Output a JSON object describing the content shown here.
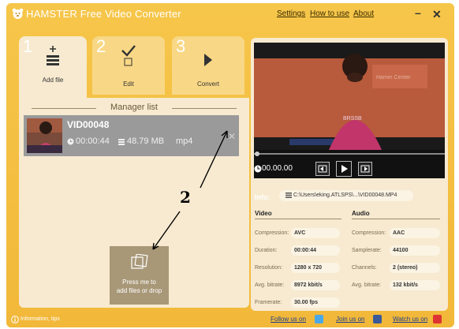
{
  "app": {
    "title": "HAMSTER Free Video Converter",
    "menu": {
      "settings": "Settings",
      "how_to_use": "How to use",
      "about": "About"
    },
    "window_buttons": {
      "minimize": "–",
      "close": "✕"
    }
  },
  "steps": [
    {
      "number": "1",
      "label": "Add file",
      "icon": "add-file-icon"
    },
    {
      "number": "2",
      "label": "Edit",
      "icon": "edit-check-icon"
    },
    {
      "number": "3",
      "label": "Convert",
      "icon": "convert-arrow-icon"
    }
  ],
  "manager": {
    "title": "Manager list",
    "file": {
      "name": "VID00048",
      "duration": "00:00:44",
      "size": "48.79 MB",
      "format": "mp4",
      "close": "✕"
    },
    "add_box_text_line1": "Press me to",
    "add_box_text_line2": "add files or drop"
  },
  "player": {
    "time": "00.00.00",
    "progress": 0.0
  },
  "info": {
    "label": "Info:",
    "path": "C:\\Users\\eking.ATLSPS\\...\\VID00048.MP4",
    "video_header": "Video",
    "audio_header": "Audio",
    "video": [
      {
        "label": "Compression:",
        "value": "AVC"
      },
      {
        "label": "Duration:",
        "value": "00:00:44"
      },
      {
        "label": "Resolution:",
        "value": "1280 x 720"
      },
      {
        "label": "Avg. bitrate:",
        "value": "8972 kbit/s"
      },
      {
        "label": "Framerate:",
        "value": "30.00 fps"
      }
    ],
    "audio": [
      {
        "label": "Compression:",
        "value": "AAC"
      },
      {
        "label": "Samplerate:",
        "value": "44100"
      },
      {
        "label": "Channels:",
        "value": "2 (stereo)"
      },
      {
        "label": "Avg. bitrate:",
        "value": "132 kbit/s"
      }
    ]
  },
  "footer": {
    "info_tips": "Information, tips",
    "follow": "Follow us on",
    "join": "Join us on",
    "watch": "Watch us on"
  },
  "annotation": {
    "number": "2"
  },
  "colors": {
    "app_bg": "#f2b83a",
    "panel_bg": "#f7ead0",
    "link": "#1c3e8a"
  }
}
